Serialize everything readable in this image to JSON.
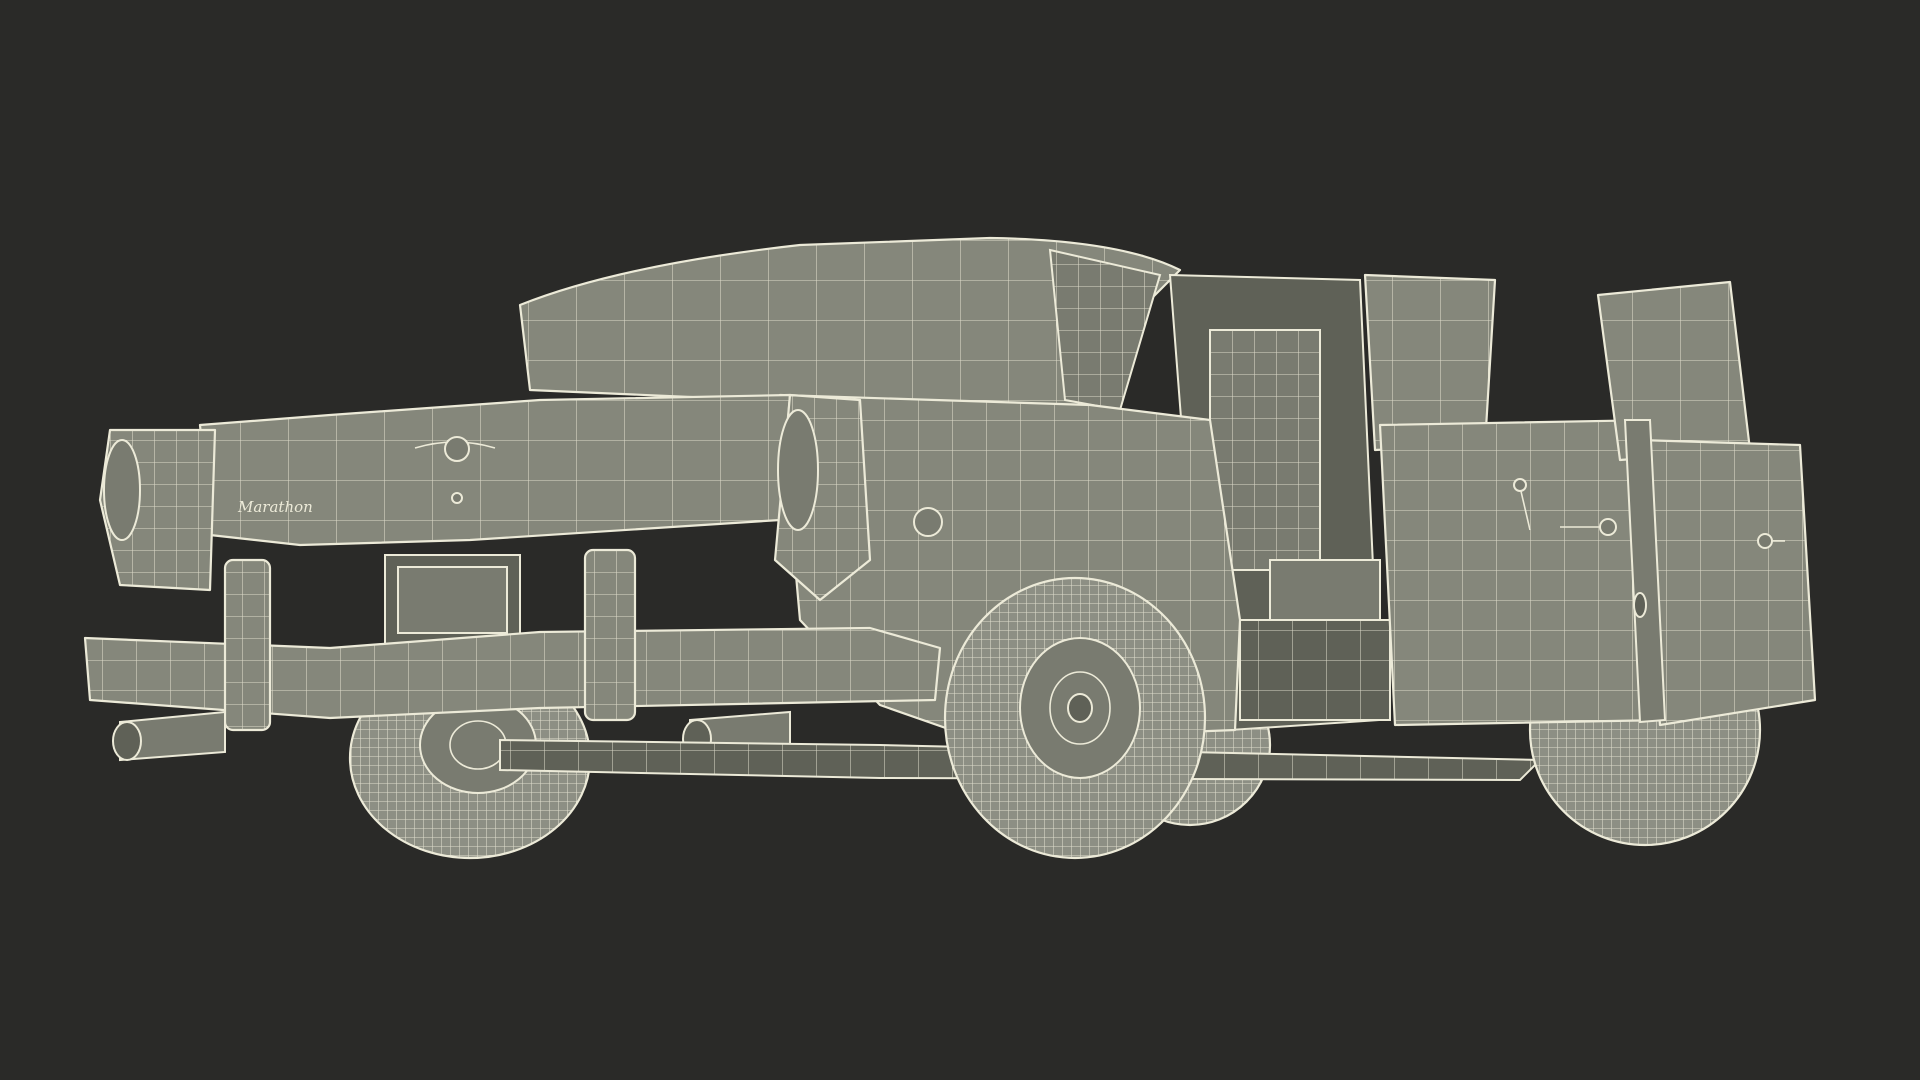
{
  "scene": {
    "background": "#2a2a28",
    "mesh_fill": "#85877b",
    "wire_color": "#ecead8"
  },
  "car": {
    "trunk_badge": "Marathon"
  }
}
